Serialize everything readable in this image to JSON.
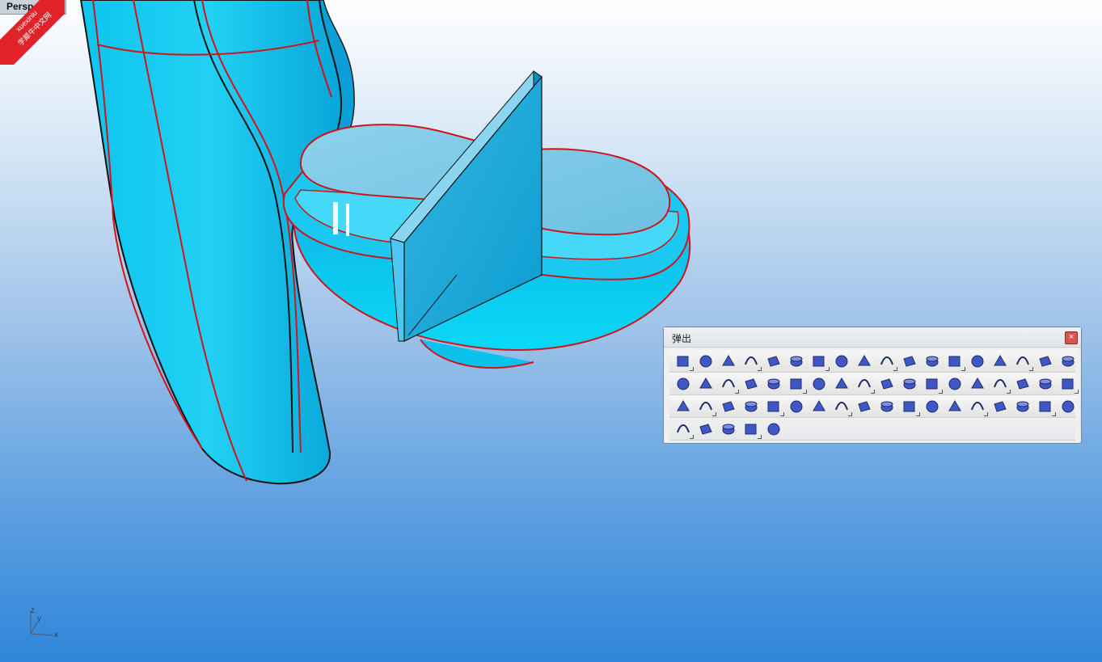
{
  "viewport": {
    "label": "Perspective",
    "axis": {
      "x": "x",
      "y": "y",
      "z": "z"
    }
  },
  "watermark": {
    "line1": "xuexiniu",
    "line2": "学犀牛中文网"
  },
  "popup": {
    "title": "弹出",
    "close_label": "×"
  },
  "colors": {
    "model_fill": "#18c8ee",
    "edge": "#d0141c",
    "bg_top": "#ffffff",
    "bg_bottom": "#2f86da",
    "toolbar_icon": "#3f58c6"
  },
  "toolbar_rows": [
    [
      "lightbulb-icon",
      "lock-icon",
      "save-icon",
      "zoom-extents-icon",
      "wireframe-sphere-icon",
      "shaded-sphere-icon",
      "color-wheel-icon",
      "gears-icon",
      "explode-icon",
      "revolve-icon",
      "blend-surface-icon",
      "patch-icon",
      "fan-surface-icon",
      "curve-degree-icon",
      "arch-curve-icon",
      "point-cloud-icon",
      "arch-surface-icon",
      "sweep-icon"
    ],
    [
      "mirror-icon",
      "control-points-icon",
      "edit-points-icon",
      "surface-frame-icon",
      "polyline-icon",
      "circle-point-icon",
      "layers-icon",
      "cylinder-outline-icon",
      "plane-icon",
      "plane-alt-icon",
      "circle-outline-icon",
      "box-icon",
      "sphere-icon",
      "boolean-union-icon",
      "boolean-intersection-icon",
      "boolean-difference-icon",
      "dimension-icon",
      "cylinder-wire-icon"
    ],
    [
      "cube-icon",
      "fillet-icon",
      "curve-blend-icon",
      "offset-curve-icon",
      "person-icon",
      "polyline-alt-icon",
      "vertical-points-icon",
      "extrude-icon",
      "point-grid-icon",
      "rail-sweep-icon",
      "cylinder-split-icon",
      "cylinder-solid-icon",
      "revolve-half-icon",
      "revolve-alt-icon",
      "surface-edge-icon",
      "funnel-icon",
      "cap-icon",
      "plane-diag-icon"
    ],
    [
      "plane-skew-icon",
      "plane-flat-icon",
      "s-curve-icon",
      "twist-surface-icon",
      "door-icon"
    ]
  ]
}
